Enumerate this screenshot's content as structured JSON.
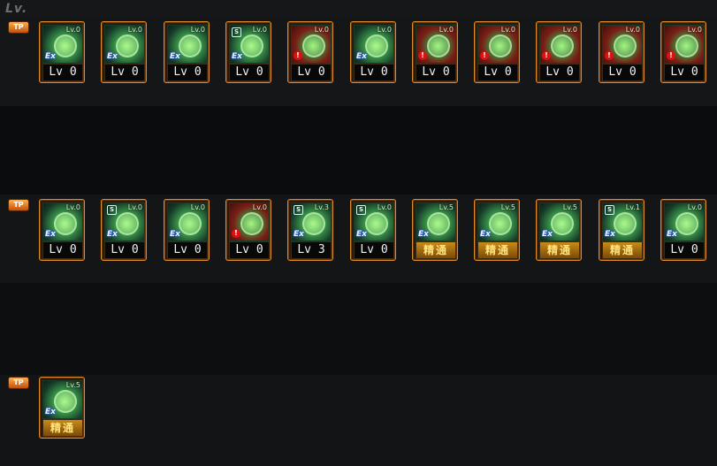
{
  "header": {
    "lv_label": "Lv."
  },
  "tp_tag": "TP",
  "rows": [
    {
      "slots": [
        {
          "level": "Lv.0",
          "label": "Lv 0",
          "badge": "ex",
          "s": false,
          "red": false
        },
        {
          "level": "Lv.0",
          "label": "Lv 0",
          "badge": "ex",
          "s": false,
          "red": false
        },
        {
          "level": "Lv.0",
          "label": "Lv 0",
          "badge": "ex",
          "s": false,
          "red": false
        },
        {
          "level": "Lv.0",
          "label": "Lv 0",
          "badge": "ex",
          "s": true,
          "red": false
        },
        {
          "level": "Lv.0",
          "label": "Lv 0",
          "badge": "warn",
          "s": false,
          "red": true
        },
        {
          "level": "Lv.0",
          "label": "Lv 0",
          "badge": "ex",
          "s": false,
          "red": false
        },
        {
          "level": "Lv.0",
          "label": "Lv 0",
          "badge": "warn",
          "s": false,
          "red": true
        },
        {
          "level": "Lv.0",
          "label": "Lv 0",
          "badge": "warn",
          "s": false,
          "red": true
        },
        {
          "level": "Lv.0",
          "label": "Lv 0",
          "badge": "warn",
          "s": false,
          "red": true
        },
        {
          "level": "Lv.0",
          "label": "Lv 0",
          "badge": "warn",
          "s": false,
          "red": true
        },
        {
          "level": "Lv.0",
          "label": "Lv 0",
          "badge": "warn",
          "s": false,
          "red": true
        }
      ]
    },
    {
      "slots": [
        {
          "level": "Lv.0",
          "label": "Lv 0",
          "badge": "ex",
          "s": false,
          "red": false
        },
        {
          "level": "Lv.0",
          "label": "Lv 0",
          "badge": "ex",
          "s": true,
          "red": false
        },
        {
          "level": "Lv.0",
          "label": "Lv 0",
          "badge": "ex",
          "s": false,
          "red": false
        },
        {
          "level": "Lv.0",
          "label": "Lv 0",
          "badge": "warn",
          "s": false,
          "red": true
        },
        {
          "level": "Lv.3",
          "label": "Lv 3",
          "badge": "ex",
          "s": true,
          "red": false
        },
        {
          "level": "Lv.0",
          "label": "Lv 0",
          "badge": "ex",
          "s": true,
          "red": false
        },
        {
          "level": "Lv.5",
          "label": "精通",
          "badge": "ex",
          "s": false,
          "red": false,
          "master": true
        },
        {
          "level": "Lv.5",
          "label": "精通",
          "badge": "ex",
          "s": false,
          "red": false,
          "master": true
        },
        {
          "level": "Lv.5",
          "label": "精通",
          "badge": "ex",
          "s": false,
          "red": false,
          "master": true
        },
        {
          "level": "Lv.1",
          "label": "精通",
          "badge": "ex",
          "s": true,
          "red": false,
          "master": true
        },
        {
          "level": "Lv.0",
          "label": "Lv 0",
          "badge": "ex",
          "s": false,
          "red": false
        }
      ]
    },
    {
      "slots": [
        {
          "level": "Lv.5",
          "label": "精通",
          "badge": "ex",
          "s": false,
          "red": false,
          "master": true
        }
      ]
    }
  ],
  "colors": {
    "frame": "#e08a2a",
    "icon_green": "#3d9c4d",
    "icon_red": "#7a1e16",
    "master_gold": "#c98a1a"
  }
}
